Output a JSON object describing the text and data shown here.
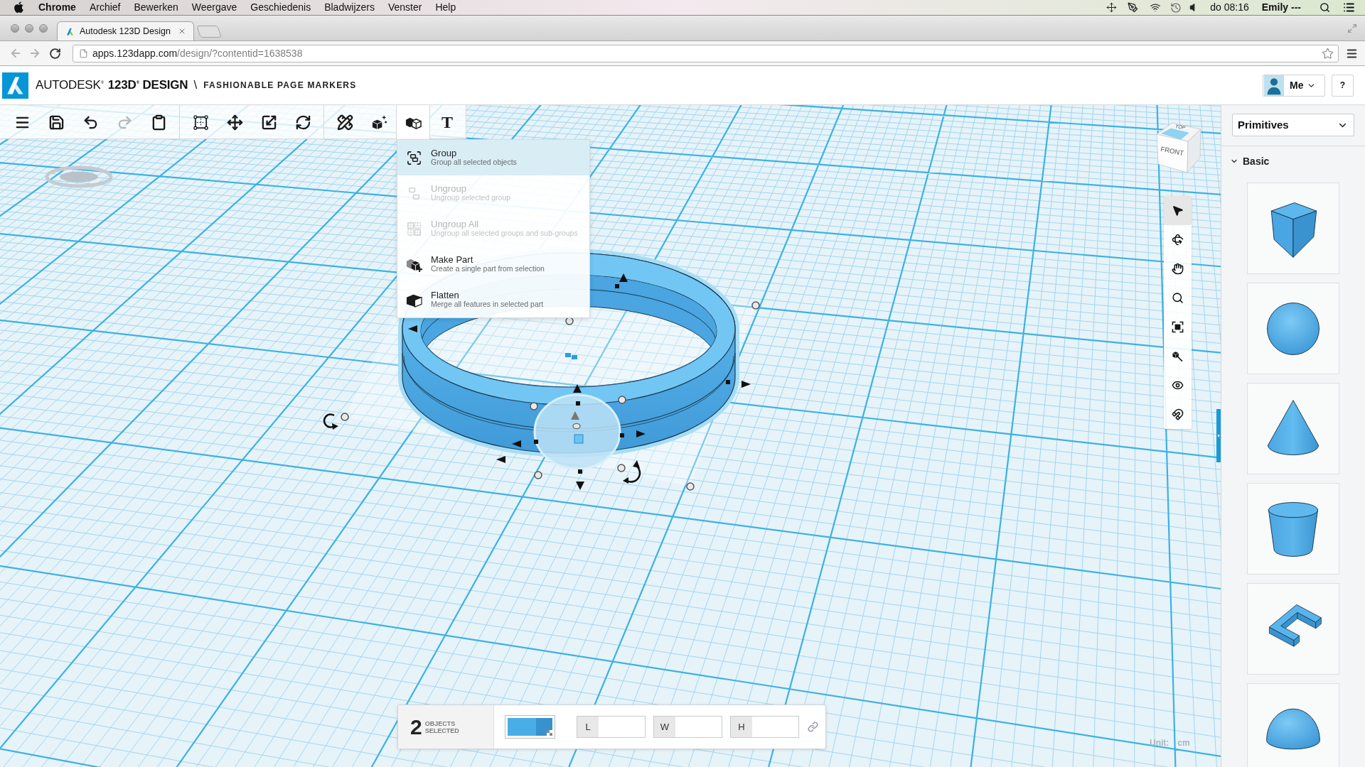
{
  "menu_bar": {
    "app": "Chrome",
    "menus": [
      "Archief",
      "Bewerken",
      "Weergave",
      "Geschiedenis",
      "Bladwijzers",
      "Venster",
      "Help"
    ],
    "clock": "do 08:16",
    "user": "Emily ---"
  },
  "browser": {
    "tabs": [
      {
        "title": "Autodesk 123D Design",
        "selected": true
      }
    ],
    "history": [
      {
        "disabled": true
      },
      {
        "disabled": true
      }
    ],
    "url": {
      "host": "apps.123dapp.com",
      "path": "/design/?contentid=1638538"
    }
  },
  "header": {
    "brand": "AUTODESK$^{®}$",
    "product": "123D$^{®}$ DESIGN",
    "separator": "\\",
    "project": "FASHIONABLE PAGE MARKERS",
    "account": "Me",
    "help": "?"
  },
  "toolbar": {
    "groups": [
      [
        {
          "selected": false,
          "disabled": false
        },
        {
          "selected": false,
          "disabled": false
        },
        {
          "selected": false,
          "disabled": false
        },
        {
          "selected": false,
          "disabled": true
        },
        {
          "selected": false,
          "disabled": false
        }
      ],
      [
        {
          "selected": false,
          "disabled": false
        },
        {
          "selected": false,
          "disabled": false
        },
        {
          "selected": false,
          "disabled": false
        },
        {
          "selected": false,
          "disabled": false
        }
      ],
      [
        {
          "selected": false,
          "disabled": false
        },
        {
          "selected": false,
          "disabled": false
        },
        {
          "selected": true,
          "disabled": false
        },
        {
          "glyph": "T",
          "selected": false,
          "disabled": false
        }
      ]
    ]
  },
  "group_menu": {
    "items": [
      {
        "title": "Group",
        "description": "Group all selected objects",
        "selected": true,
        "disabled": false
      },
      {
        "title": "Ungroup",
        "description": "Ungroup selected group",
        "selected": false,
        "disabled": true
      },
      {
        "title": "Ungroup All",
        "description": "Ungroup all selected groups and sub-groups",
        "selected": false,
        "disabled": true
      },
      {
        "title": "Make Part",
        "description": "Create a single part from selection",
        "selected": false,
        "disabled": false
      },
      {
        "title": "Flatten",
        "description": "Merge all features in selected part",
        "selected": false,
        "disabled": false
      }
    ]
  },
  "view_cube": {
    "top": "TOP",
    "front": "FRONT"
  },
  "nav_tools": [
    {
      "selected": true
    },
    {
      "selected": false
    },
    {
      "selected": false
    },
    {
      "selected": false
    },
    {
      "selected": false
    },
    {
      "selected": false
    },
    {
      "selected": false
    },
    {
      "selected": false
    }
  ],
  "selection": {
    "count": "2",
    "label": "OBJECTS SELECTED",
    "fields": [
      {
        "label": "L"
      },
      {
        "label": "W"
      },
      {
        "label": "H"
      }
    ]
  },
  "unit": {
    "label": "Unit:",
    "value": "cm"
  },
  "panel": {
    "category": "Primitives",
    "sections": [
      {
        "title": "Basic",
        "expanded": true
      }
    ]
  }
}
